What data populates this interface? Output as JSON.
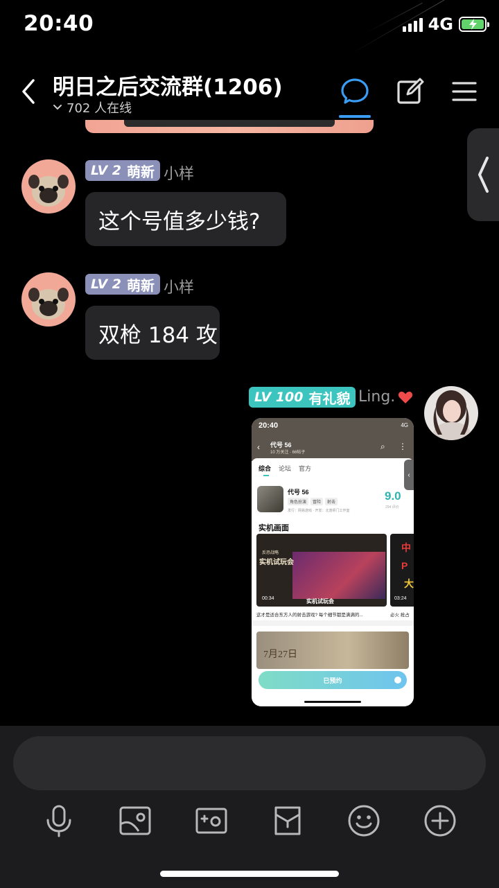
{
  "status": {
    "time": "20:40",
    "network": "4G"
  },
  "header": {
    "title": "明日之后交流群(1206)",
    "online": "702 人在线",
    "accent_color": "#3b9cf3"
  },
  "icons": {
    "back": "chevron-left-icon",
    "chat": "chat-bubble-icon",
    "edit": "edit-icon",
    "menu": "menu-icon",
    "side": "chevron-left-icon"
  },
  "messages": [
    {
      "badge_level": "LV 2",
      "badge_title": "萌新",
      "nickname": "小样",
      "text": "这个号值多少钱?"
    },
    {
      "badge_level": "LV 2",
      "badge_title": "萌新",
      "nickname": "小样",
      "text": "双枪 184 攻"
    },
    {
      "badge_level": "LV 100",
      "badge_title": "有礼貌",
      "nickname": "Ling.",
      "image": {
        "time": "20:40",
        "network": "4G",
        "game_title": "代号 56",
        "game_sub": "10 万关注 · 66帖子",
        "tabs": [
          "综合",
          "论坛",
          "官方"
        ],
        "game_name": "代号 56",
        "tags": [
          "角色扮演",
          "冒险",
          "射击"
        ],
        "publisher": "发行：网易游戏 · 开发：北落师门工作室",
        "score": "9.0",
        "score_sub": "294 评价",
        "section": "实机画面",
        "video1_small": "反恐战略",
        "video1_title": "实机试玩会",
        "video1_duration": "00:34",
        "video1_caption": "实机试玩会",
        "video1_desc": "这才是适合东方人的射击游戏? 每个细节都是满满的...",
        "video2_chars": [
          "中",
          "P",
          "大"
        ],
        "video2_duration": "03:24",
        "video2_desc": "必火 抢占",
        "banner_date": "7月27日",
        "button": "已预约"
      }
    }
  ],
  "toolbar": [
    "microphone-icon",
    "image-icon",
    "camera-icon",
    "gift-card-icon",
    "emoji-icon",
    "plus-circle-icon"
  ]
}
